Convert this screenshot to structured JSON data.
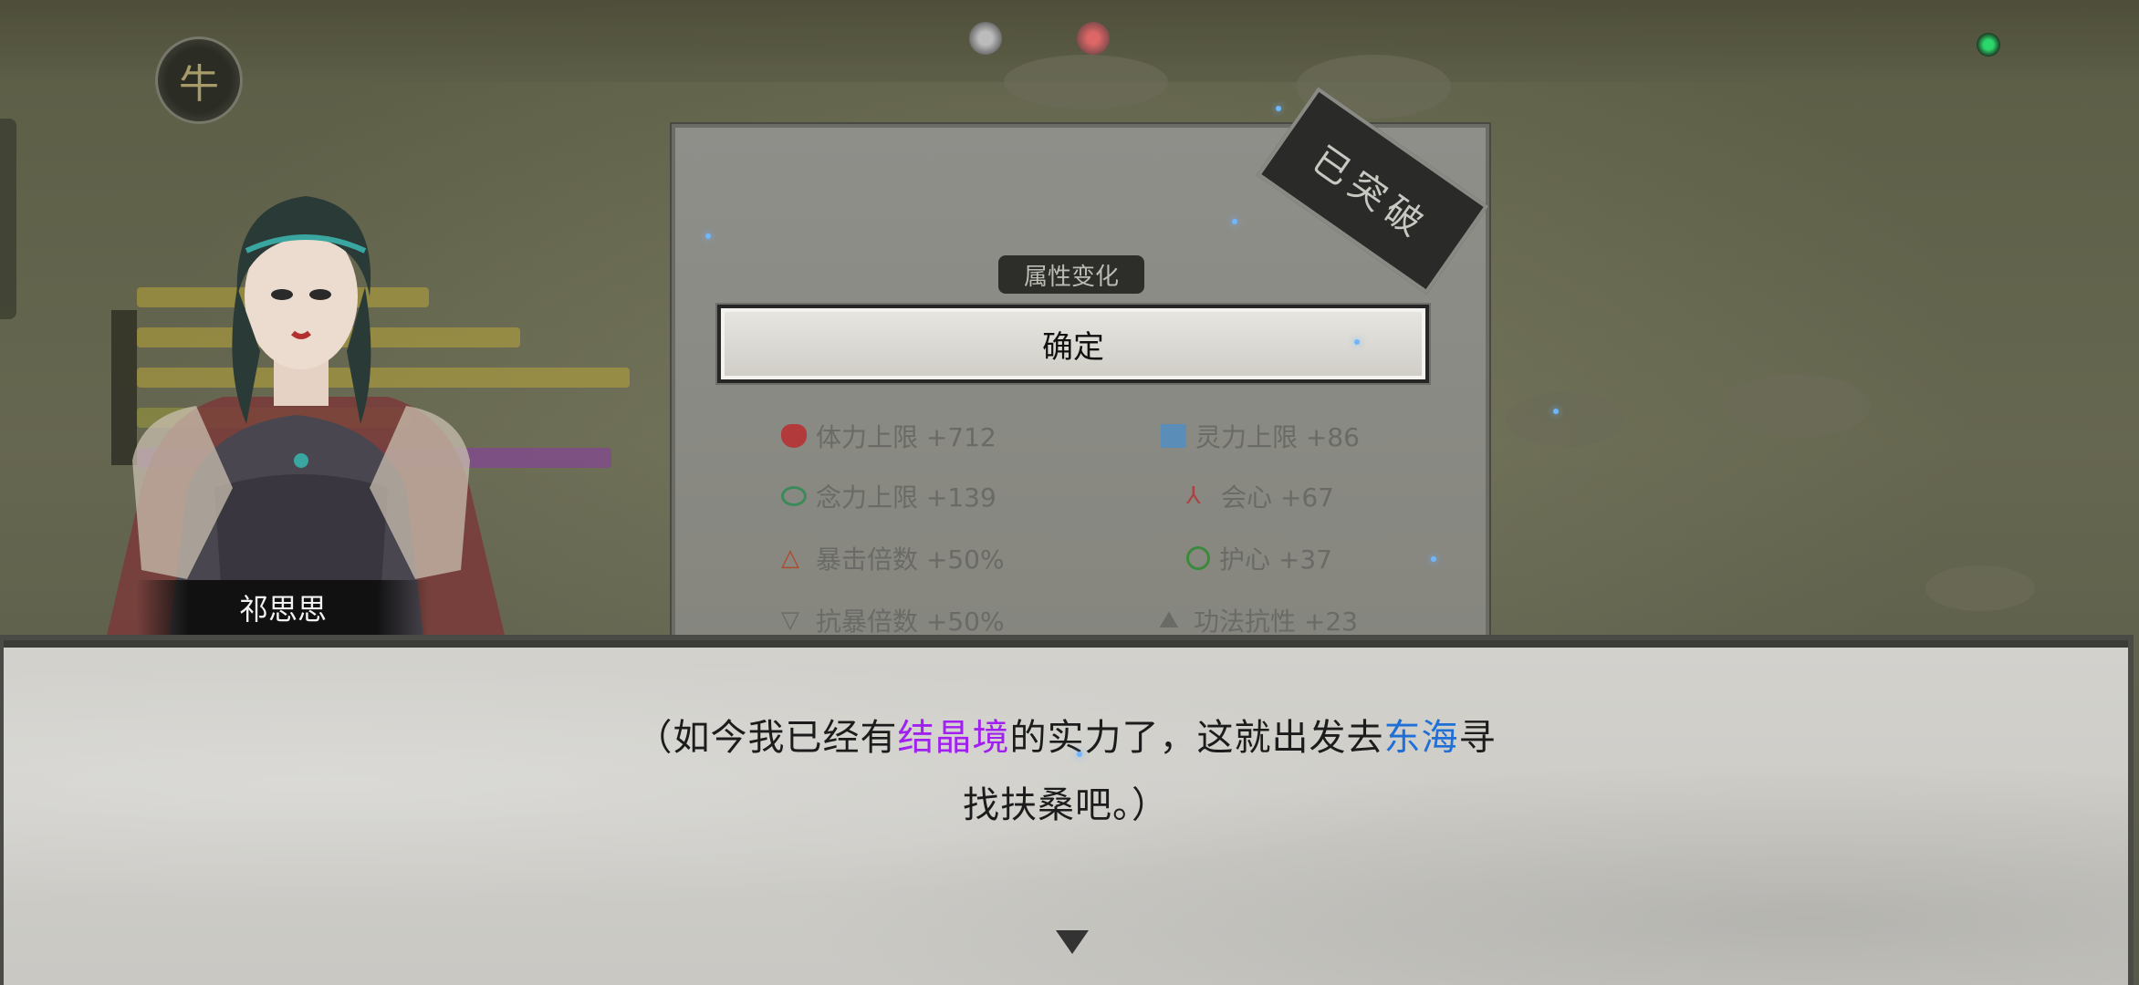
{
  "emblem": {
    "glyph": "⽜",
    "icon": "seal-emblem-icon"
  },
  "top_icons": [
    "silver-coin-icon",
    "red-gem-icon"
  ],
  "status_icon": "green-orb-icon",
  "attribute_panel": {
    "tab_label": "属性变化",
    "stamp_text": "已突破",
    "confirm_label": "确定",
    "stats": [
      {
        "icon": "heart-icon",
        "text": "体力上限 +712",
        "color": "#b33a3a"
      },
      {
        "icon": "spirit-icon",
        "text": "灵力上限 +86",
        "color": "#5a8db8"
      },
      {
        "icon": "eye-icon",
        "text": "念力上限 +139",
        "color": "#3c8a5a"
      },
      {
        "icon": "crit-icon",
        "text": "会心 +67",
        "color": "#a44"
      },
      {
        "icon": "triangle-warning-icon",
        "text": "暴击倍数 +50%",
        "color": "#b04a2a"
      },
      {
        "icon": "shield-icon",
        "text": "护心 +37",
        "color": "#3a8a3a"
      },
      {
        "icon": "down-triangle-icon",
        "text": "抗暴倍数 +50%",
        "color": "#6a6a66"
      },
      {
        "icon": "hill-icon",
        "text": "功法抗性 +23",
        "color": "#6a6a66"
      }
    ]
  },
  "character": {
    "name": "祁思思"
  },
  "dialog": {
    "part1": "（如今我已经有",
    "highlight1": "结晶境",
    "part2": "的实力了，这就出发去",
    "highlight2": "东海",
    "part3": "寻",
    "line2": "找扶桑吧。）",
    "colors": {
      "highlight1": "#a020f0",
      "highlight2": "#1f6fd6"
    }
  }
}
